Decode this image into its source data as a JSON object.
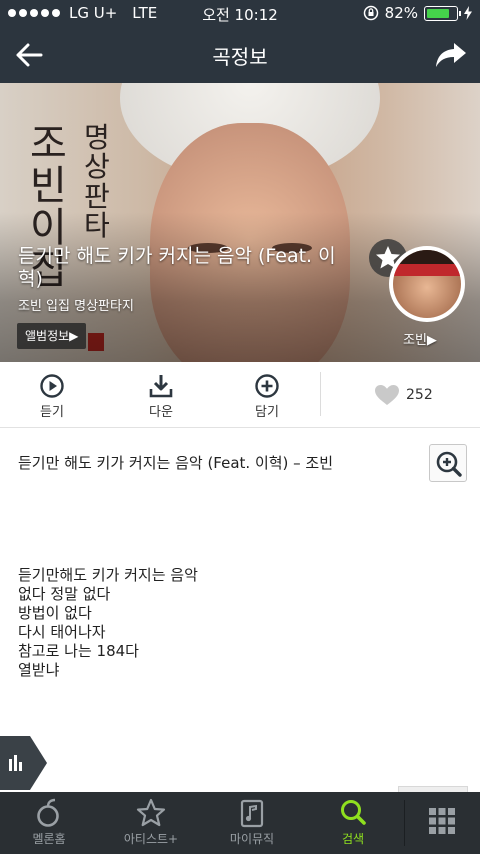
{
  "status_bar": {
    "carrier": "LG U+",
    "network": "LTE",
    "time": "오전 10:12",
    "battery": "82%",
    "battery_level": 0.82,
    "battery_color": "#45d34b"
  },
  "navbar": {
    "title": "곡정보",
    "back_icon": "back-arrow-icon",
    "share_icon": "share-icon"
  },
  "hero": {
    "calligraphy_left": "조빈이집",
    "calligraphy_right": "명상판타",
    "song_title": "듣기만 해도 키가 커지는 음악 (Feat. 이혁)",
    "album_line": "조빈 입집 명상판타지",
    "album_button": "앨범정보▶",
    "artist_name": "조빈▶"
  },
  "actions": {
    "listen": "듣기",
    "download": "다운",
    "add": "담기",
    "like_count": "252"
  },
  "lyrics": {
    "header": "듣기만 해도 키가 커지는 음악 (Feat. 이혁) – 조빈",
    "lines": [
      "듣기만해도 키가 커지는 음악",
      "없다 정말 없다",
      "방법이 없다",
      "다시 태어나자",
      "참고로 나는 184다",
      "열받냐"
    ]
  },
  "tabbar": {
    "items": [
      {
        "label": "멜론홈",
        "icon": "melon-home-icon"
      },
      {
        "label": "아티스트+",
        "icon": "star-icon"
      },
      {
        "label": "마이뮤직",
        "icon": "my-music-icon"
      },
      {
        "label": "검색",
        "icon": "search-icon"
      }
    ],
    "active_index": 3,
    "active_color": "#8fe01f"
  }
}
